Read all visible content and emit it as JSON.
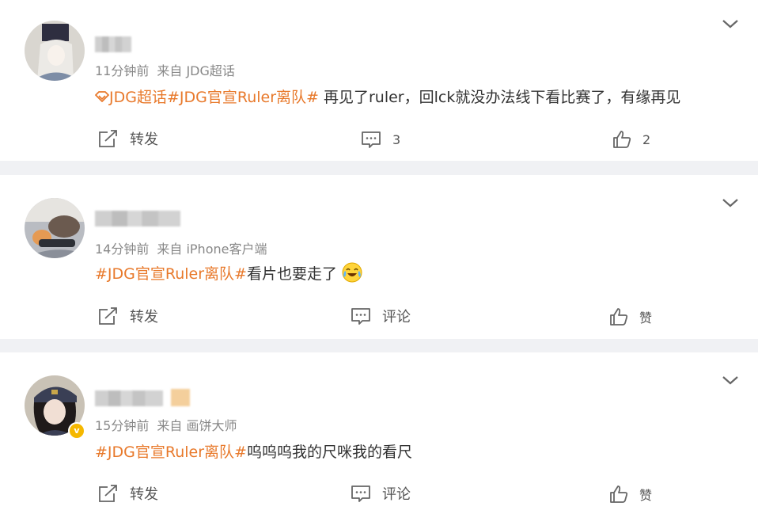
{
  "posts": [
    {
      "time": "11分钟前",
      "source": "来自 JDG超话",
      "tags": [
        "JDG超话",
        "#JDG官宣Ruler离队#"
      ],
      "text": " 再见了ruler，回lck就没办法线下看比赛了，有缘再见",
      "actions": {
        "repost": "转发",
        "comment": "3",
        "like": "2"
      }
    },
    {
      "time": "14分钟前",
      "source": "来自 iPhone客户端",
      "tags": [
        "#JDG官宣Ruler离队#"
      ],
      "text": "看片也要走了",
      "actions": {
        "repost": "转发",
        "comment": "评论",
        "like": "赞"
      }
    },
    {
      "time": "15分钟前",
      "source": "来自 画饼大师",
      "tags": [
        "#JDG官宣Ruler离队#"
      ],
      "text": "呜呜呜我的尺咪我的看尺",
      "actions": {
        "repost": "转发",
        "comment": "评论",
        "like": "赞"
      }
    }
  ],
  "colors": {
    "tag": "#e8792b",
    "text": "#333333",
    "meta": "#888888",
    "verified": "#f5b800"
  },
  "icons": [
    "chevron-down-icon",
    "repost-icon",
    "comment-icon",
    "like-icon",
    "supertopic-icon",
    "crying-laugh-emoji",
    "verified-badge"
  ]
}
